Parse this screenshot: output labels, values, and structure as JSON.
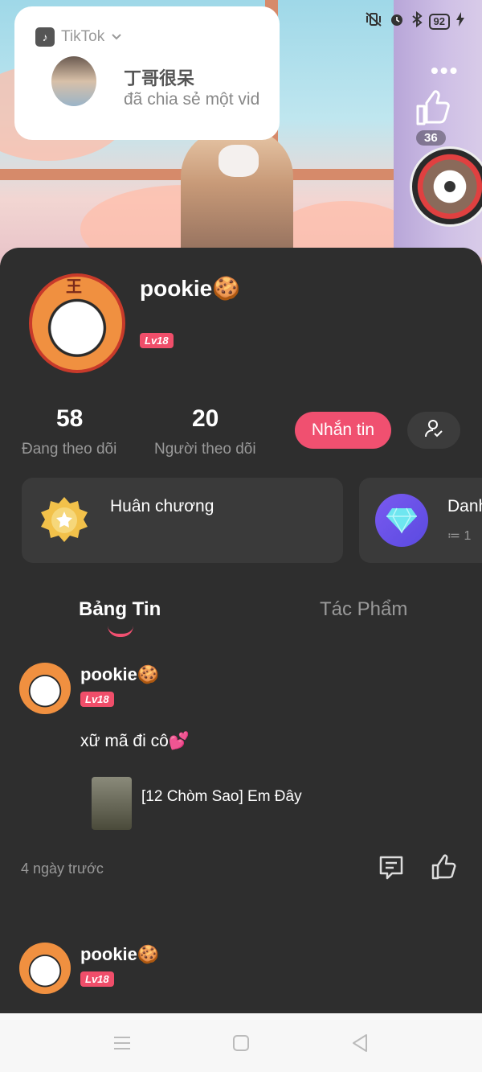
{
  "status_bar": {
    "battery": "92",
    "icons": [
      "vibrate-off-icon",
      "alarm-icon",
      "bluetooth-icon",
      "battery-icon",
      "charging-icon"
    ]
  },
  "notification": {
    "app_name": "TikTok",
    "title": "丁哥很呆",
    "body": "đã chia sẻ một vid"
  },
  "floating": {
    "like_count": "36"
  },
  "profile": {
    "username": "pookie🍪",
    "level": "Lv18",
    "following_count": "58",
    "following_label": "Đang theo dõi",
    "followers_count": "20",
    "followers_label": "Người theo dõi",
    "message_button": "Nhắn tin"
  },
  "cards": [
    {
      "title": "Huân chương"
    },
    {
      "title": "Danh",
      "sub": "≔ 1"
    }
  ],
  "tabs": [
    {
      "label": "Bảng Tin",
      "active": true
    },
    {
      "label": "Tác Phẩm",
      "active": false
    }
  ],
  "posts": [
    {
      "username": "pookie🍪",
      "level": "Lv18",
      "text": "xữ mã đi cô💕",
      "link_title": "[12 Chòm Sao] Em Đây",
      "time": "4 ngày trước"
    },
    {
      "username": "pookie🍪",
      "level": "Lv18"
    }
  ],
  "colors": {
    "accent": "#f05070",
    "panel": "#2e2e2e",
    "card": "#3a3a3a"
  }
}
